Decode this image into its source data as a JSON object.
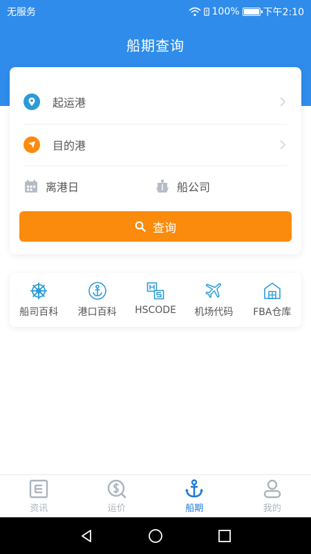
{
  "status_bar": {
    "carrier": "无服务",
    "battery": "100%",
    "time": "下午2:10"
  },
  "header": {
    "title": "船期查询"
  },
  "search": {
    "origin_label": "起运港",
    "dest_label": "目的港",
    "date_label": "离港日",
    "company_label": "船公司",
    "query_label": "查询"
  },
  "tools": [
    {
      "label": "船司百科",
      "icon": "ship-wheel-icon"
    },
    {
      "label": "港口百科",
      "icon": "anchor-icon"
    },
    {
      "label": "HSCODE",
      "icon": "hs-code-icon"
    },
    {
      "label": "机场代码",
      "icon": "airplane-icon"
    },
    {
      "label": "FBA仓库",
      "icon": "warehouse-icon"
    }
  ],
  "bottom_nav": [
    {
      "label": "资讯",
      "icon": "news-icon",
      "active": false
    },
    {
      "label": "运价",
      "icon": "price-icon",
      "active": false
    },
    {
      "label": "船期",
      "icon": "anchor-icon",
      "active": true
    },
    {
      "label": "我的",
      "icon": "profile-icon",
      "active": false
    }
  ],
  "colors": {
    "header_blue": "#2f8ceb",
    "accent_orange": "#fb8b0c",
    "active_blue": "#1f79d6",
    "inactive_grey": "#aab3bf",
    "tool_blue": "#2b9bd6"
  }
}
